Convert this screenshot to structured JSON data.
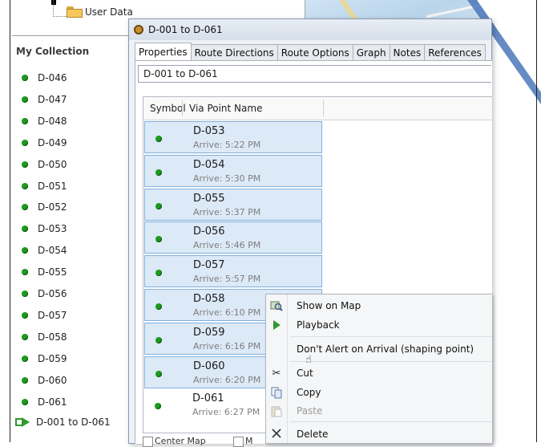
{
  "tree": {
    "user_data_label": "User Data"
  },
  "collection": {
    "title": "My Collection",
    "items": [
      "D-046",
      "D-047",
      "D-048",
      "D-049",
      "D-050",
      "D-051",
      "D-052",
      "D-053",
      "D-054",
      "D-055",
      "D-056",
      "D-057",
      "D-058",
      "D-059",
      "D-060",
      "D-061"
    ],
    "route_label": "D-001 to D-061"
  },
  "dialog": {
    "title": "D-001 to D-061",
    "tabs": [
      "Properties",
      "Route Directions",
      "Route Options",
      "Graph",
      "Notes",
      "References"
    ],
    "active_tab": "Properties",
    "name_value": "D-001 to D-061",
    "columns": {
      "symbol": "Symbol",
      "via": "Via Point Name"
    },
    "rows": [
      {
        "name": "D-053",
        "arrive": "Arrive: 5:22 PM",
        "selected": true
      },
      {
        "name": "D-054",
        "arrive": "Arrive: 5:30 PM",
        "selected": true
      },
      {
        "name": "D-055",
        "arrive": "Arrive: 5:37 PM",
        "selected": true
      },
      {
        "name": "D-056",
        "arrive": "Arrive: 5:46 PM",
        "selected": true
      },
      {
        "name": "D-057",
        "arrive": "Arrive: 5:57 PM",
        "selected": true
      },
      {
        "name": "D-058",
        "arrive": "Arrive: 6:10 PM",
        "selected": true
      },
      {
        "name": "D-059",
        "arrive": "Arrive: 6:16 PM",
        "selected": true
      },
      {
        "name": "D-060",
        "arrive": "Arrive: 6:20 PM",
        "selected": true
      },
      {
        "name": "D-061",
        "arrive": "Arrive: 6:27 PM",
        "selected": false
      }
    ],
    "bottom": {
      "center_map": "Center Map",
      "second": "M"
    }
  },
  "context_menu": {
    "items": [
      {
        "label": "Show on Map",
        "icon": "magnifier-map-icon",
        "enabled": true
      },
      {
        "label": "Playback",
        "icon": "play-icon",
        "enabled": true
      },
      {
        "label": "Don't Alert on Arrival (shaping point)",
        "icon": "",
        "enabled": true
      },
      {
        "label": "Cut",
        "icon": "scissors-icon",
        "enabled": true
      },
      {
        "label": "Copy",
        "icon": "copy-icon",
        "enabled": true
      },
      {
        "label": "Paste",
        "icon": "paste-icon",
        "enabled": false
      },
      {
        "label": "Delete",
        "icon": "delete-x-icon",
        "enabled": true
      }
    ]
  },
  "colors": {
    "dot_green": "#1e9a1e",
    "selection": "#dce9f7",
    "selection_border": "#7fb0dd",
    "map_accent": "#4a78b8"
  }
}
